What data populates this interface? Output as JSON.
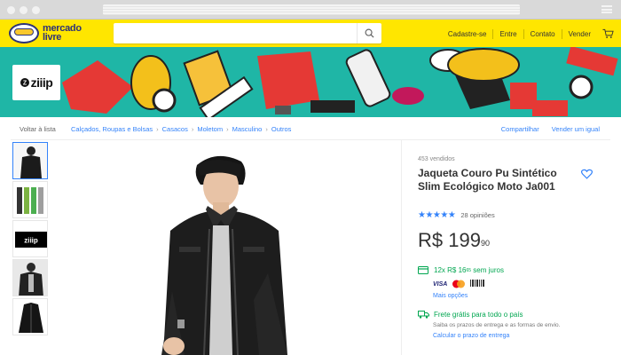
{
  "header": {
    "logo_line1": "mercado",
    "logo_line2": "livre",
    "search_placeholder": "",
    "nav": [
      "Cadastre-se",
      "Entre",
      "Contato",
      "Vender"
    ]
  },
  "banner": {
    "store_name": "ziiip",
    "store_mark": "Z"
  },
  "breadcrumb": {
    "back": "Voltar à lista",
    "items": [
      "Calçados, Roupas e Bolsas",
      "Casacos",
      "Moletom",
      "Masculino",
      "Outros"
    ],
    "separator": "›",
    "actions": [
      "Compartilhar",
      "Vender um igual"
    ]
  },
  "product": {
    "sold": "453 vendidos",
    "title": "Jaqueta Couro Pu Sintético Slim Ecológico Moto Ja001",
    "stars": "★★★★★",
    "opinions": "28 opiniões",
    "currency": "R$",
    "price_int": "199",
    "price_cents": "90",
    "installments_text": "12x R$ 16",
    "installments_cents": "65",
    "installments_suffix": "sem juros",
    "card_visa": "VISA",
    "more_payment": "Mais opções",
    "shipping_title": "Frete grátis para todo o país",
    "shipping_sub": "Saiba os prazos de entrega e as formas de envio.",
    "shipping_link": "Calcular o prazo de entrega"
  },
  "thumb_label": "ziiip",
  "colors": {
    "brand_yellow": "#ffe600",
    "link_blue": "#3483fa",
    "green": "#00a650",
    "banner_teal": "#1fb6a6"
  }
}
